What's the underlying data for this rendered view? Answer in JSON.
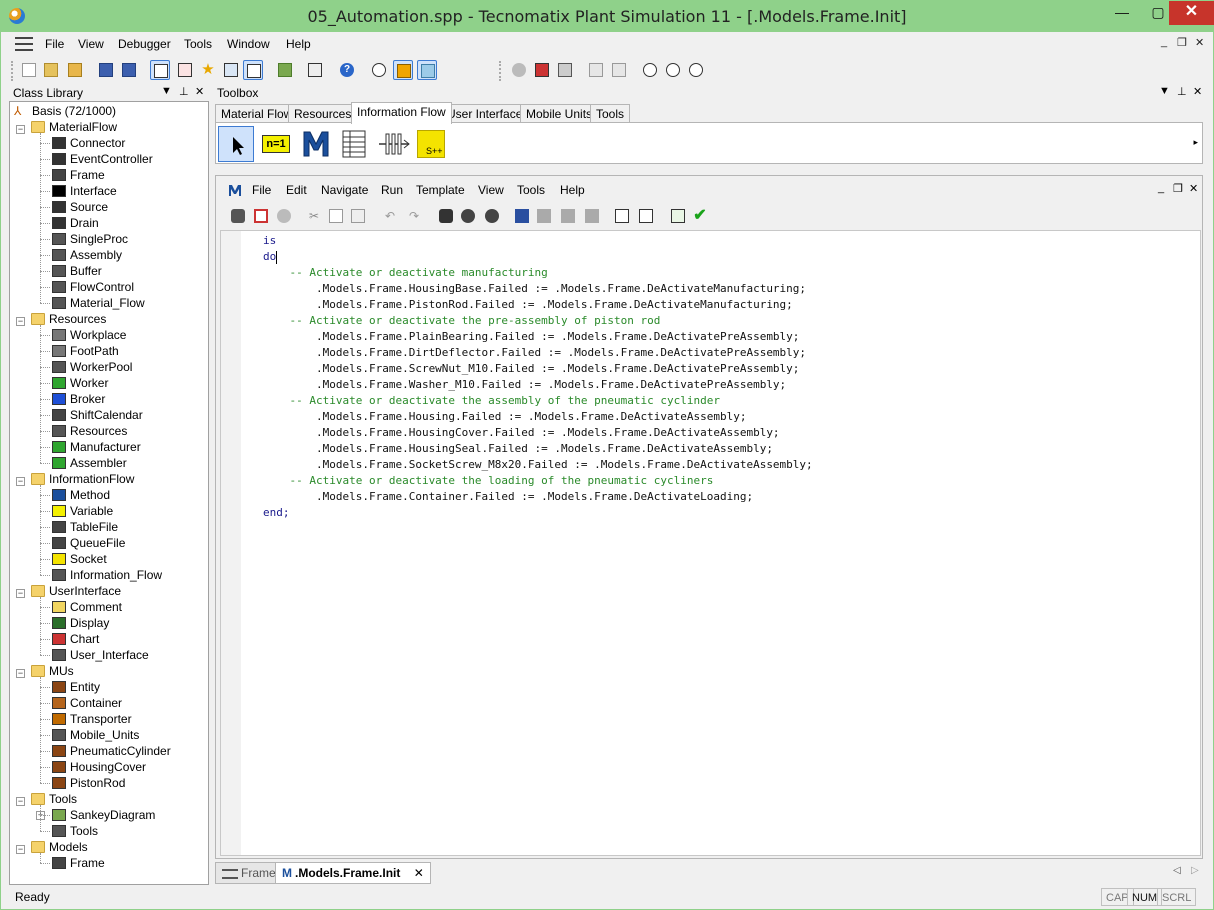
{
  "window": {
    "title": "05_Automation.spp - Tecnomatix Plant Simulation 11 - [.Models.Frame.Init]",
    "controls": {
      "minimize": "—",
      "maximize": "▢",
      "close": "✕"
    }
  },
  "menubar": {
    "items": [
      "File",
      "View",
      "Debugger",
      "Tools",
      "Window",
      "Help"
    ],
    "right": [
      "_",
      "❐",
      "✕"
    ]
  },
  "class_library": {
    "title": "Class Library",
    "root": "Basis (72/1000)",
    "folders": [
      {
        "name": "MaterialFlow",
        "items": [
          "Connector",
          "EventController",
          "Frame",
          "Interface",
          "Source",
          "Drain",
          "SingleProc",
          "Assembly",
          "Buffer",
          "FlowControl",
          "Material_Flow"
        ]
      },
      {
        "name": "Resources",
        "items": [
          "Workplace",
          "FootPath",
          "WorkerPool",
          "Worker",
          "Broker",
          "ShiftCalendar",
          "Resources",
          "Manufacturer",
          "Assembler"
        ]
      },
      {
        "name": "InformationFlow",
        "items": [
          "Method",
          "Variable",
          "TableFile",
          "QueueFile",
          "Socket",
          "Information_Flow"
        ]
      },
      {
        "name": "UserInterface",
        "items": [
          "Comment",
          "Display",
          "Chart",
          "User_Interface"
        ]
      },
      {
        "name": "MUs",
        "items": [
          "Entity",
          "Container",
          "Transporter",
          "Mobile_Units",
          "PneumaticCylinder",
          "HousingCover",
          "PistonRod"
        ]
      },
      {
        "name": "Tools",
        "items": [
          "SankeyDiagram",
          "Tools"
        ]
      },
      {
        "name": "Models",
        "items": [
          "Frame"
        ]
      }
    ]
  },
  "toolbox": {
    "title": "Toolbox",
    "tabs": [
      "Material Flow",
      "Resources",
      "Information Flow",
      "User Interface",
      "Mobile Units",
      "Tools"
    ],
    "active_tab": "Information Flow",
    "tool_labels": {
      "variable": "n=1",
      "socket": "S++"
    }
  },
  "editor": {
    "menu": [
      "File",
      "Edit",
      "Navigate",
      "Run",
      "Template",
      "View",
      "Tools",
      "Help"
    ],
    "code_lines": [
      {
        "text": "is",
        "cls": "kw",
        "indent": 0
      },
      {
        "text": "do",
        "cls": "kw",
        "indent": 0
      },
      {
        "text": "    -- Activate or deactivate manufacturing",
        "cls": "cm",
        "indent": 0
      },
      {
        "text": "        .Models.Frame.HousingBase.Failed := .Models.Frame.DeActivateManufacturing;",
        "cls": "st",
        "indent": 0
      },
      {
        "text": "        .Models.Frame.PistonRod.Failed := .Models.Frame.DeActivateManufacturing;",
        "cls": "st",
        "indent": 0
      },
      {
        "text": "    -- Activate or deactivate the pre-assembly of piston rod",
        "cls": "cm",
        "indent": 0
      },
      {
        "text": "        .Models.Frame.PlainBearing.Failed := .Models.Frame.DeActivatePreAssembly;",
        "cls": "st",
        "indent": 0
      },
      {
        "text": "        .Models.Frame.DirtDeflector.Failed := .Models.Frame.DeActivatePreAssembly;",
        "cls": "st",
        "indent": 0
      },
      {
        "text": "        .Models.Frame.ScrewNut_M10.Failed := .Models.Frame.DeActivatePreAssembly;",
        "cls": "st",
        "indent": 0
      },
      {
        "text": "        .Models.Frame.Washer_M10.Failed := .Models.Frame.DeActivatePreAssembly;",
        "cls": "st",
        "indent": 0
      },
      {
        "text": "    -- Activate or deactivate the assembly of the pneumatic cyclinder",
        "cls": "cm",
        "indent": 0
      },
      {
        "text": "        .Models.Frame.Housing.Failed := .Models.Frame.DeActivateAssembly;",
        "cls": "st",
        "indent": 0
      },
      {
        "text": "        .Models.Frame.HousingCover.Failed := .Models.Frame.DeActivateAssembly;",
        "cls": "st",
        "indent": 0
      },
      {
        "text": "        .Models.Frame.HousingSeal.Failed := .Models.Frame.DeActivateAssembly;",
        "cls": "st",
        "indent": 0
      },
      {
        "text": "        .Models.Frame.SocketScrew_M8x20.Failed := .Models.Frame.DeActivateAssembly;",
        "cls": "st",
        "indent": 0
      },
      {
        "text": "    -- Activate or deactivate the loading of the pneumatic cycliners",
        "cls": "cm",
        "indent": 0
      },
      {
        "text": "        .Models.Frame.Container.Failed := .Models.Frame.DeActivateLoading;",
        "cls": "st",
        "indent": 0
      },
      {
        "text": "end;",
        "cls": "kw",
        "indent": 0
      }
    ]
  },
  "doc_tabs": {
    "inactive": "Frame",
    "active": ".Models.Frame.Init",
    "close": "✕"
  },
  "statusbar": {
    "text": "Ready",
    "indicators": [
      "CAP",
      "NUM",
      "SCRL"
    ],
    "active_indicator": "NUM"
  }
}
